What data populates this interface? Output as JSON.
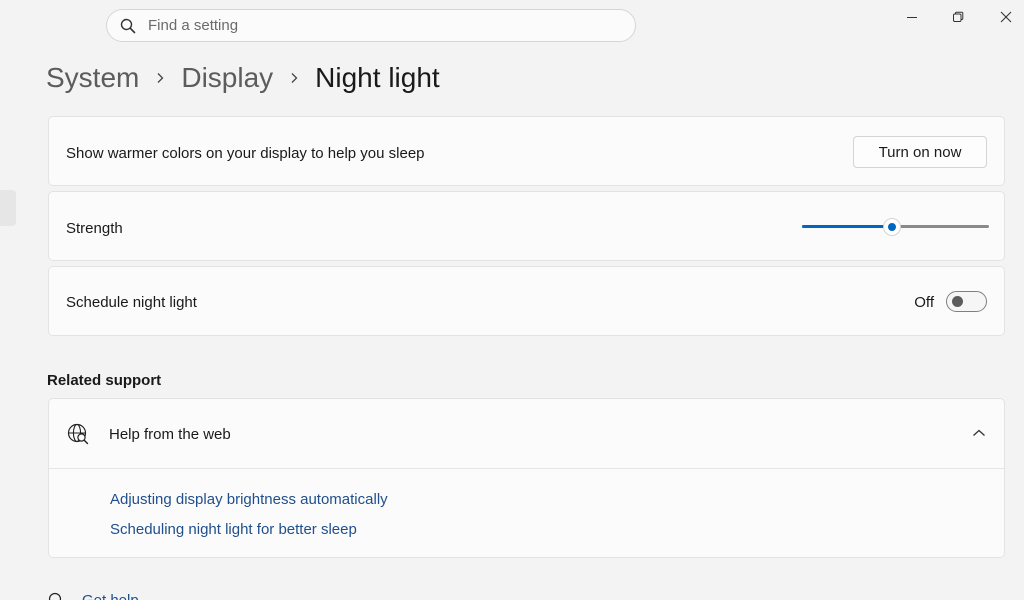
{
  "search": {
    "placeholder": "Find a setting",
    "value": ""
  },
  "window_controls": {
    "minimize_icon": "minimize-icon",
    "restore_icon": "restore-icon",
    "close_icon": "close-icon"
  },
  "breadcrumb": {
    "items": [
      "System",
      "Display"
    ],
    "current": "Night light"
  },
  "night_light": {
    "description": "Show warmer colors on your display to help you sleep",
    "button_label": "Turn on now"
  },
  "strength": {
    "label": "Strength",
    "value_fraction": 0.48,
    "accent": "#0067c0"
  },
  "schedule": {
    "label": "Schedule night light",
    "state": "Off"
  },
  "related_support": {
    "title": "Related support",
    "help": {
      "label": "Help from the web",
      "icon": "globe-search-icon",
      "expanded": true,
      "links": [
        "Adjusting display brightness automatically",
        "Scheduling night light for better sleep"
      ]
    }
  },
  "get_help": {
    "label": "Get help"
  },
  "colors": {
    "accent": "#0067c0",
    "link": "#1f4f8c",
    "background": "#f3f3f3",
    "card": "#fbfbfb"
  }
}
